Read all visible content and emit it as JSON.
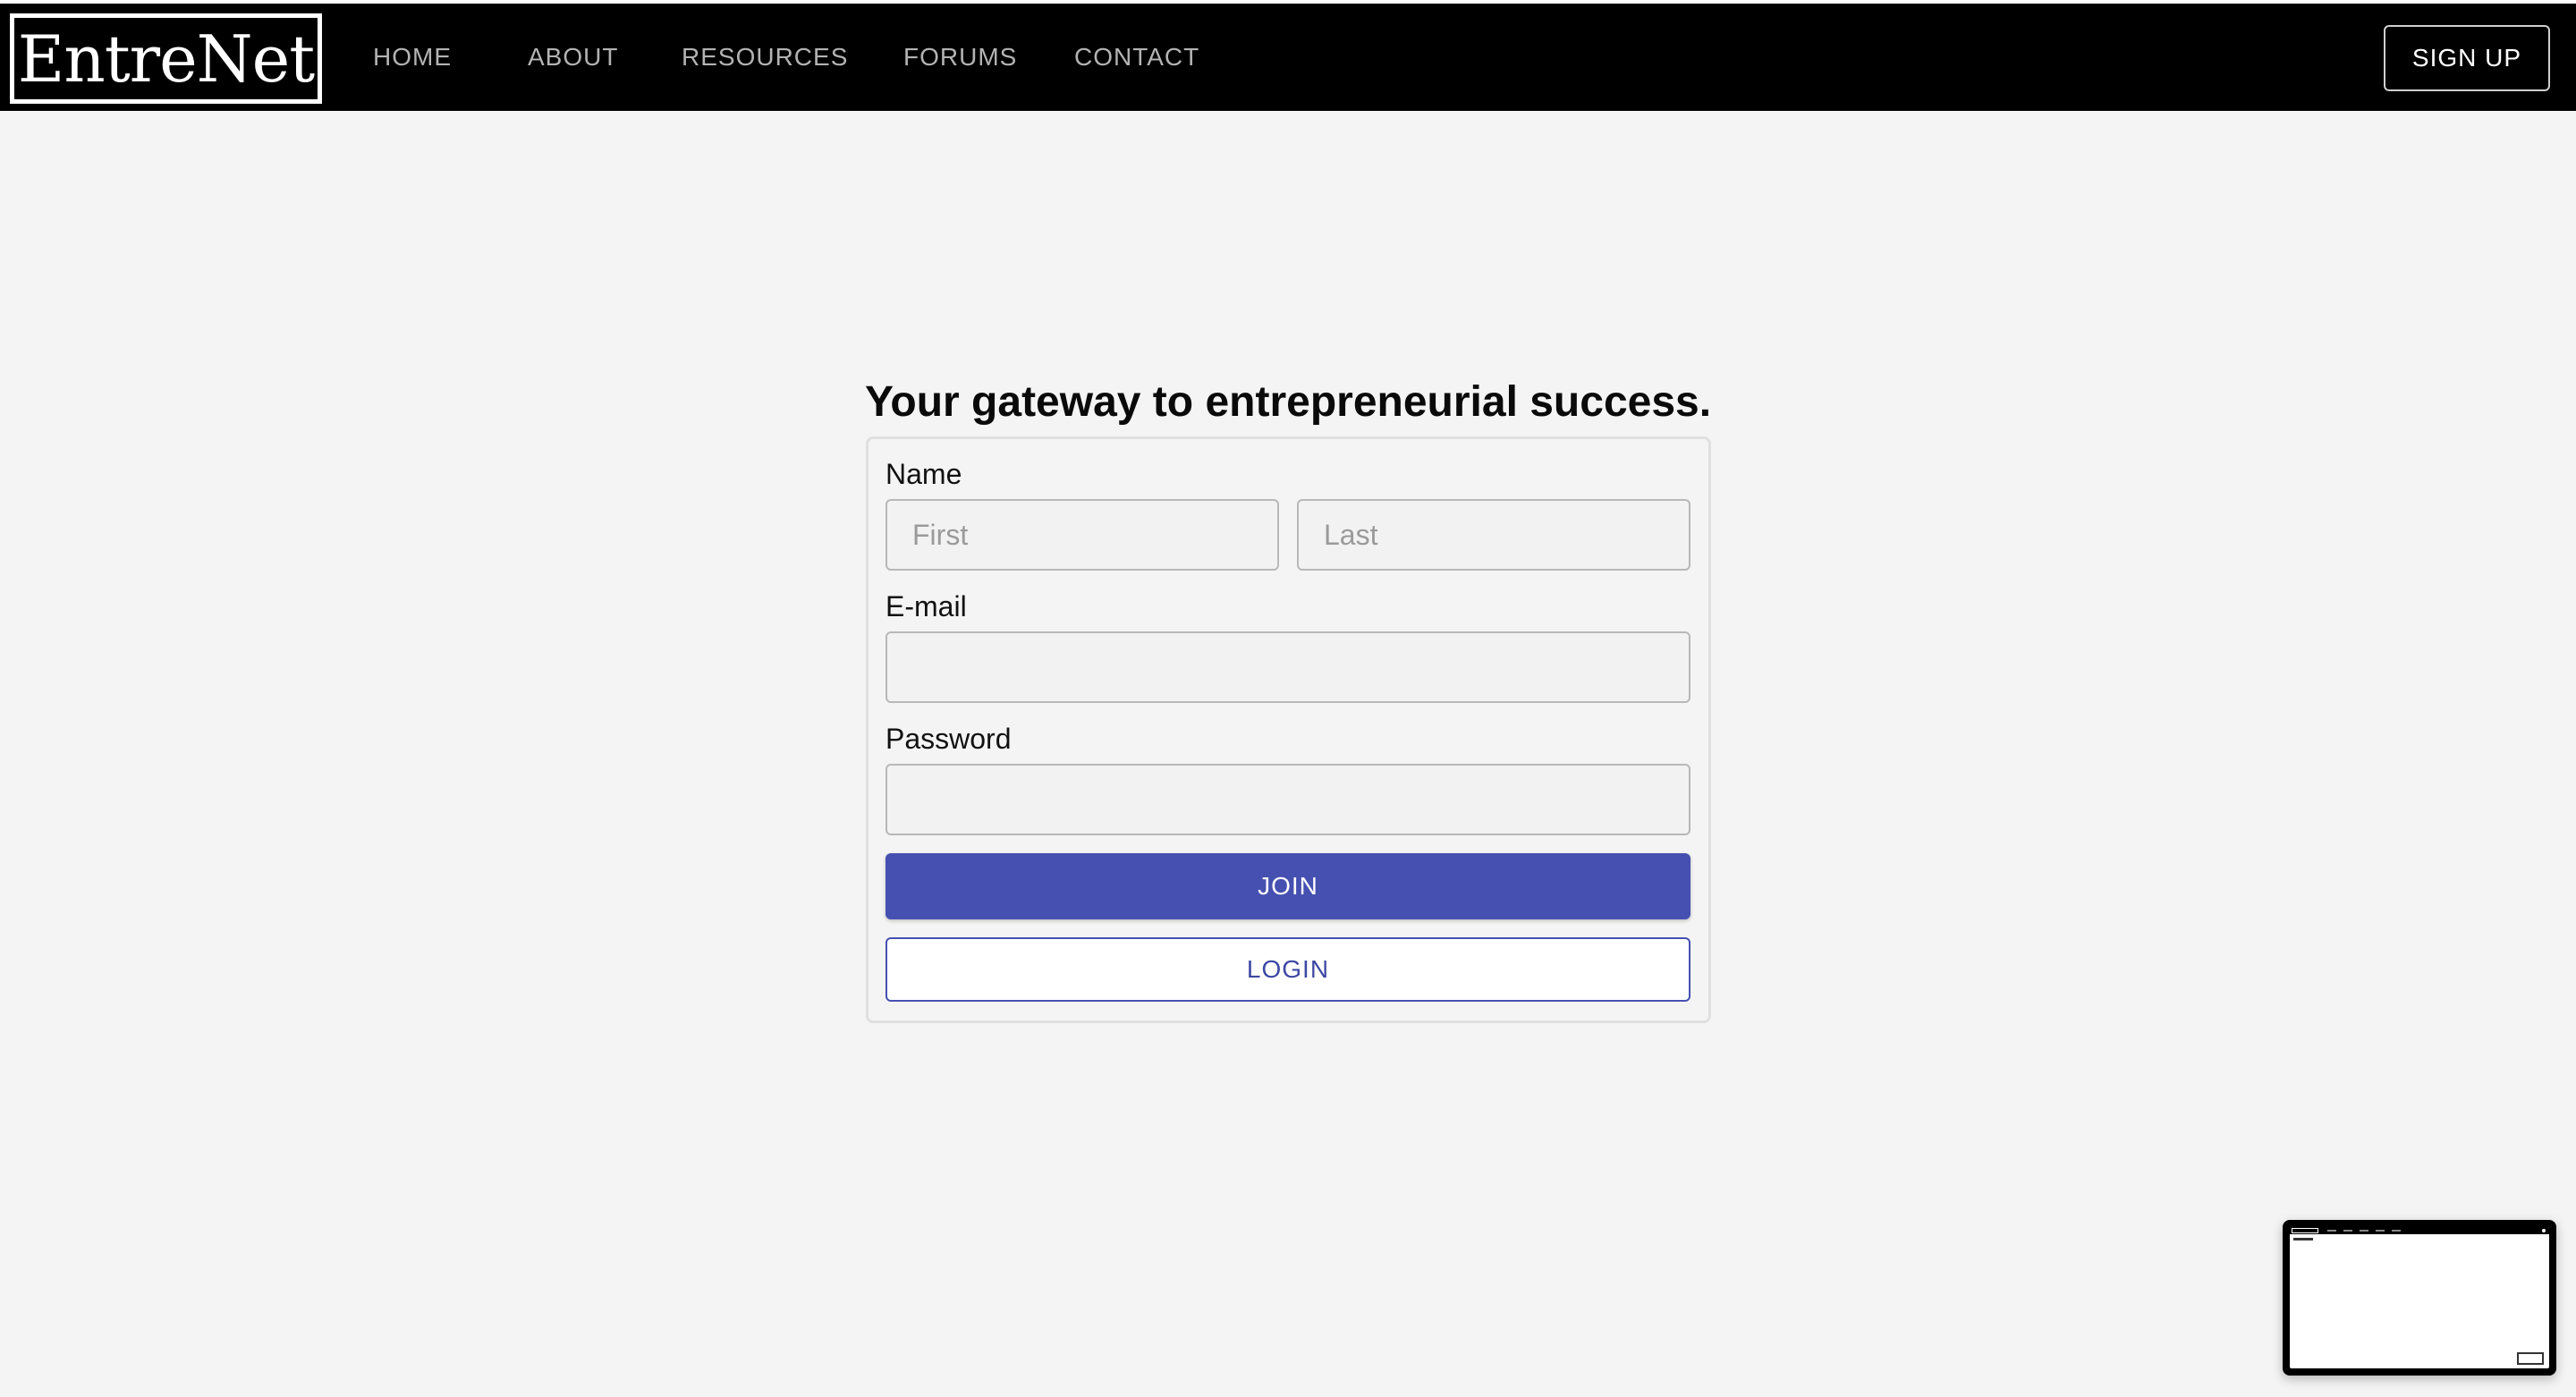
{
  "header": {
    "logo_text": "EntreNet",
    "nav": [
      {
        "label": "HOME"
      },
      {
        "label": "ABOUT"
      },
      {
        "label": "RESOURCES"
      },
      {
        "label": "FORUMS"
      },
      {
        "label": "CONTACT"
      }
    ],
    "signup_label": "SIGN UP"
  },
  "main": {
    "headline": "Your gateway to entrepreneurial success.",
    "form": {
      "name_label": "Name",
      "first_placeholder": "First",
      "last_placeholder": "Last",
      "email_label": "E-mail",
      "email_value": "",
      "password_label": "Password",
      "password_value": "",
      "join_label": "JOIN",
      "login_label": "LOGIN"
    }
  },
  "colors": {
    "accent": "#4650b0",
    "nav_background": "#000000",
    "page_background": "#f4f4f4"
  }
}
